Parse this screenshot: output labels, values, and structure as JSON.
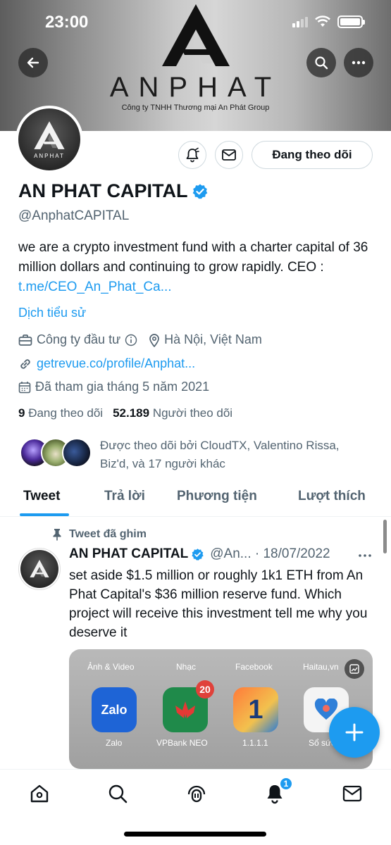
{
  "status_bar": {
    "time": "23:00"
  },
  "banner": {
    "brand_name": "ANPHAT",
    "brand_subtitle": "Công ty TNHH Thương mại An Phát Group"
  },
  "avatar_text": "ANPHAT",
  "profile": {
    "follow_button_label": "Đang theo dõi",
    "display_name": "AN PHAT CAPITAL",
    "handle": "@AnphatCAPITAL",
    "bio_text": "we are a crypto investment fund with a charter capital of 36 million dollars and continuing to grow rapidly. CEO : ",
    "bio_link": "t.me/CEO_An_Phat_Ca...",
    "translate_bio": "Dịch tiểu sử",
    "category": "Công ty đầu tư",
    "location": "Hà Nội, Việt Nam",
    "website": "getrevue.co/profile/Anphat...",
    "joined": "Đã tham gia tháng 5 năm 2021",
    "following_count": "9",
    "following_label": "Đang theo dõi",
    "followers_count": "52.189",
    "followers_label": "Người theo dõi",
    "followed_by": "Được theo dõi bởi CloudTX, Valentino Rissa, Biz'd, và 17 người khác"
  },
  "tabs": [
    {
      "label": "Tweet",
      "active": true
    },
    {
      "label": "Trả lời",
      "active": false
    },
    {
      "label": "Phương tiện",
      "active": false
    },
    {
      "label": "Lượt thích",
      "active": false
    }
  ],
  "pinned_tweet": {
    "pin_label": "Tweet đã ghim",
    "author_name": "AN PHAT CAPITAL",
    "handle_date": "@An... · 18/07/2022",
    "text": "set aside $1.5 million or roughly 1k1 ETH from An Phat Capital's $36 million reserve fund. Which project will receive this investment tell me why you deserve it",
    "media": {
      "top_labels": [
        "Ảnh & Video",
        "Nhạc",
        "Facebook",
        "Haitau,vn"
      ],
      "apps": [
        {
          "label": "Zalo",
          "icon_text": "Zalo"
        },
        {
          "label": "VPBank NEO",
          "badge": "20"
        },
        {
          "label": "1.1.1.1",
          "icon_text": "1"
        },
        {
          "label": "Sổ sức..."
        }
      ]
    }
  },
  "bottom_nav": {
    "notification_badge": "1"
  },
  "icons": {
    "back": "back-arrow-icon",
    "search": "search-icon",
    "more": "more-horizontal-icon",
    "bell": "bell-plus-icon",
    "mail": "mail-icon",
    "verified": "verified-badge-icon",
    "briefcase": "briefcase-icon",
    "location": "location-pin-icon",
    "link": "link-icon",
    "calendar": "calendar-icon",
    "pin": "pin-icon",
    "compose": "compose-plus-icon",
    "home": "home-icon",
    "spaces": "spaces-icon",
    "notifications": "bell-icon"
  },
  "colors": {
    "accent": "#1d9bf0",
    "text_primary": "#0f1419",
    "text_secondary": "#536471"
  }
}
